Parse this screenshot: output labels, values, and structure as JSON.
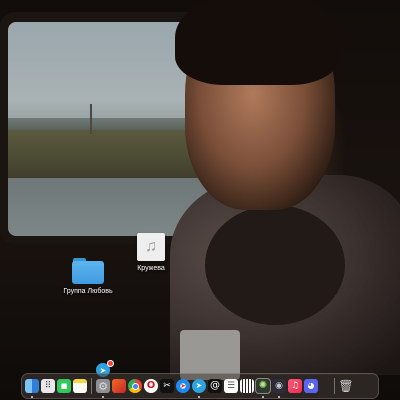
{
  "desktop": {
    "icons": [
      {
        "name": "folder",
        "label": "Группа Любовь",
        "icon": "folder-icon",
        "color": "#4aa6e8"
      },
      {
        "name": "audio-file",
        "label": "Кружева",
        "icon": "music-note-icon"
      }
    ]
  },
  "dock": {
    "background": "rgba(70,60,56,0.55)",
    "apps": [
      {
        "name": "finder",
        "icon": "finder-icon",
        "glyph": "",
        "running": true
      },
      {
        "name": "launchpad",
        "icon": "launchpad-grid-icon",
        "glyph": "⠿",
        "running": false
      },
      {
        "name": "facetime",
        "icon": "video-camera-icon",
        "glyph": "■",
        "running": false
      },
      {
        "name": "notes",
        "icon": "notes-icon",
        "glyph": "",
        "running": false
      },
      {
        "name": "system-settings",
        "icon": "gear-icon",
        "glyph": "⚙",
        "running": true
      },
      {
        "name": "pages",
        "icon": "pages-icon",
        "glyph": "",
        "running": false
      },
      {
        "name": "chrome",
        "icon": "chrome-icon",
        "glyph": "",
        "running": false
      },
      {
        "name": "opera",
        "icon": "opera-icon",
        "glyph": "O",
        "running": false
      },
      {
        "name": "capcut",
        "icon": "capcut-icon",
        "glyph": "✂",
        "running": false
      },
      {
        "name": "safari",
        "icon": "compass-icon",
        "glyph": "➤",
        "running": false
      },
      {
        "name": "telegram",
        "icon": "paper-plane-icon",
        "glyph": "➤",
        "running": true
      },
      {
        "name": "threads",
        "icon": "threads-icon",
        "glyph": "@",
        "running": false
      },
      {
        "name": "reminders",
        "icon": "list-icon",
        "glyph": "☰",
        "running": false
      },
      {
        "name": "piano",
        "icon": "piano-keys-icon",
        "glyph": "",
        "running": false
      },
      {
        "name": "activity",
        "icon": "activity-icon",
        "glyph": "✺",
        "running": true
      },
      {
        "name": "vpn",
        "icon": "shield-icon",
        "glyph": "◉",
        "running": true
      },
      {
        "name": "music",
        "icon": "music-note-icon",
        "glyph": "♫",
        "running": false
      },
      {
        "name": "discord",
        "icon": "discord-icon",
        "glyph": "◕",
        "running": false
      }
    ],
    "trash": {
      "name": "trash",
      "icon": "trash-icon",
      "glyph": "🗑"
    }
  },
  "dragging": {
    "app": "telegram",
    "icon": "paper-plane-icon",
    "glyph": "➤",
    "badge_color": "#ff3b30"
  }
}
